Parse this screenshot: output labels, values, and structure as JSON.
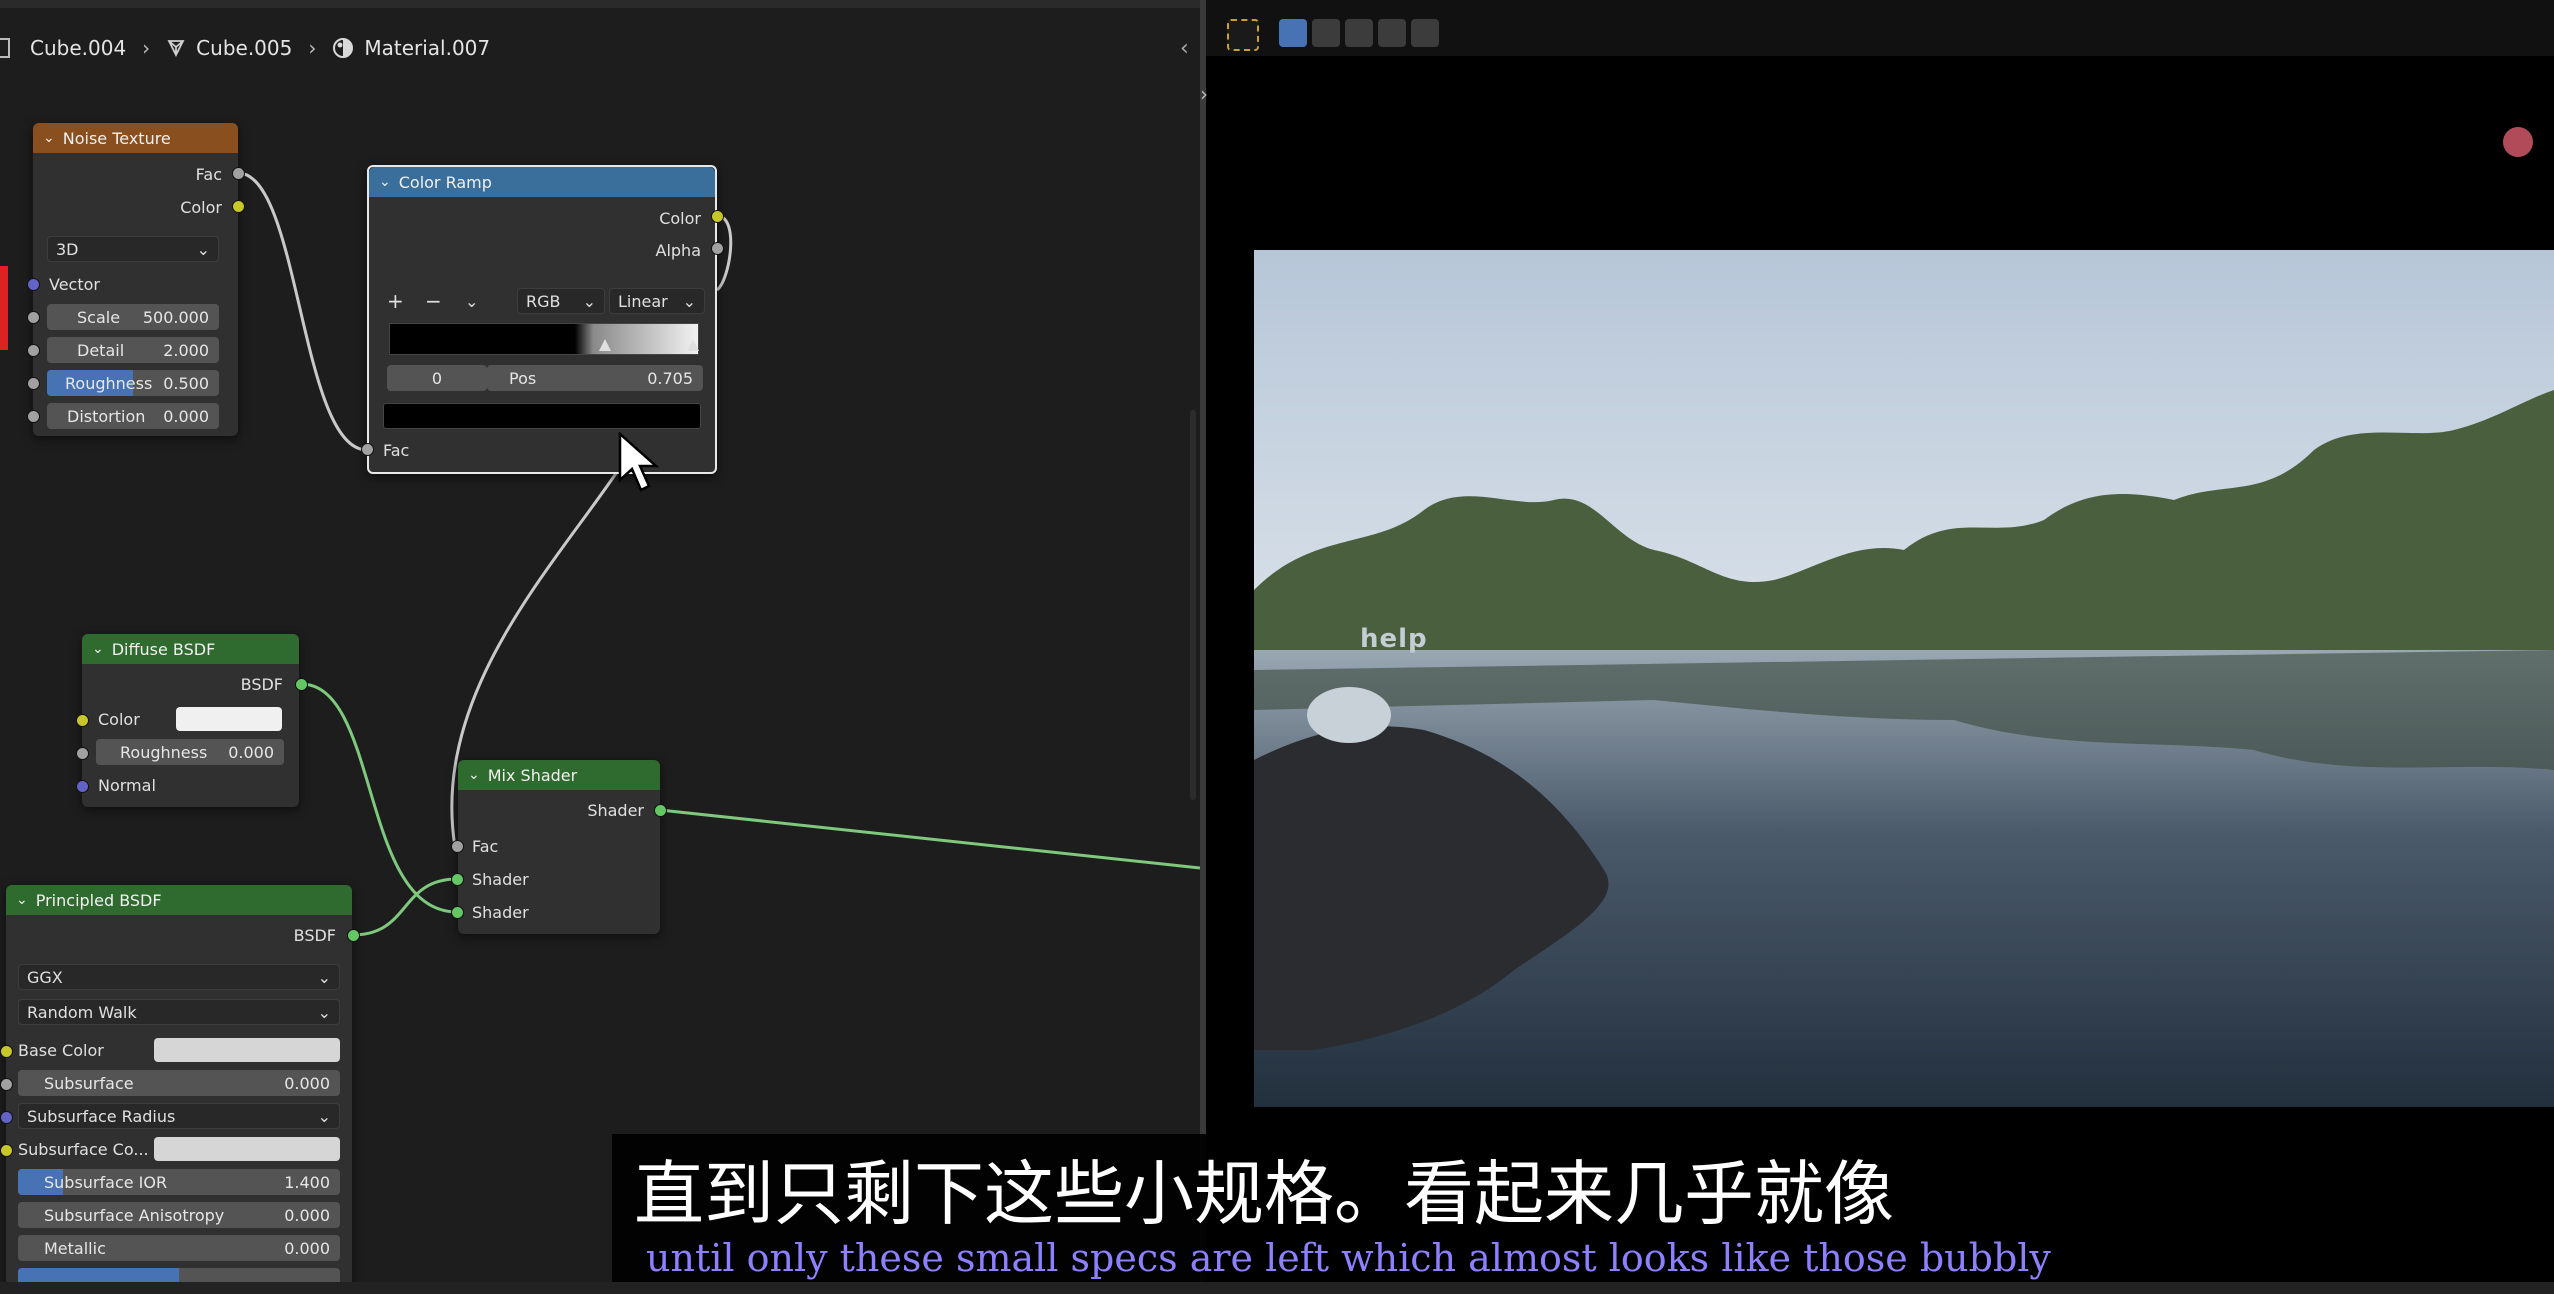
{
  "breadcrumb": {
    "object": "Cube.004",
    "mesh": "Cube.005",
    "material": "Material.007"
  },
  "nodes": {
    "noise_texture": {
      "title": "Noise Texture",
      "out_fac": "Fac",
      "out_color": "Color",
      "dimensions": "3D",
      "in_vector": "Vector",
      "scale_label": "Scale",
      "scale_value": "500.000",
      "detail_label": "Detail",
      "detail_value": "2.000",
      "roughness_label": "Roughness",
      "roughness_value": "0.500",
      "distortion_label": "Distortion",
      "distortion_value": "0.000"
    },
    "color_ramp": {
      "title": "Color Ramp",
      "out_color": "Color",
      "out_alpha": "Alpha",
      "add_btn": "+",
      "remove_btn": "−",
      "color_mode": "RGB",
      "interpolation": "Linear",
      "stop_index": "0",
      "pos_label": "Pos",
      "pos_value": "0.705",
      "in_fac": "Fac"
    },
    "diffuse": {
      "title": "Diffuse BSDF",
      "out_bsdf": "BSDF",
      "color_label": "Color",
      "roughness_label": "Roughness",
      "roughness_value": "0.000",
      "normal_label": "Normal"
    },
    "mix_shader": {
      "title": "Mix Shader",
      "out_shader": "Shader",
      "in_fac": "Fac",
      "in_shader1": "Shader",
      "in_shader2": "Shader"
    },
    "principled": {
      "title": "Principled BSDF",
      "out_bsdf": "BSDF",
      "distribution": "GGX",
      "subsurface_method": "Random Walk",
      "base_color_label": "Base Color",
      "subsurface_label": "Subsurface",
      "subsurface_value": "0.000",
      "subsurface_radius_label": "Subsurface Radius",
      "subsurface_color_label": "Subsurface Co...",
      "subsurface_ior_label": "Subsurface IOR",
      "subsurface_ior_value": "1.400",
      "subsurface_aniso_label": "Subsurface Anisotropy",
      "subsurface_aniso_value": "0.000",
      "metallic_label": "Metallic",
      "metallic_value": "0.000"
    }
  },
  "viewport": {
    "overlay_text": "help"
  },
  "subtitles": {
    "chinese": "直到只剩下这些小规格。看起来几乎就像",
    "english": "until only these small specs are left which almost looks like those bubbly"
  },
  "colors": {
    "header_texture": "#8a4f1e",
    "header_converter": "#3a6e9b",
    "header_shader": "#2f6a2f",
    "accent_blue": "#4772b3",
    "subtitle_english": "#8c80ff"
  }
}
